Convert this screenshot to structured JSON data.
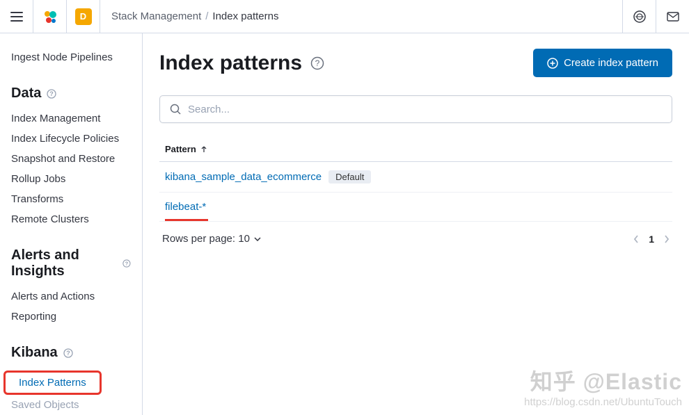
{
  "breadcrumb": {
    "parent": "Stack Management",
    "current": "Index patterns"
  },
  "space_badge": "D",
  "sidebar": {
    "ingest": {
      "pipelines": "Ingest Node Pipelines"
    },
    "data": {
      "heading": "Data",
      "items": [
        "Index Management",
        "Index Lifecycle Policies",
        "Snapshot and Restore",
        "Rollup Jobs",
        "Transforms",
        "Remote Clusters"
      ]
    },
    "alerts": {
      "heading": "Alerts and Insights",
      "items": [
        "Alerts and Actions",
        "Reporting"
      ]
    },
    "kibana": {
      "heading": "Kibana",
      "items": [
        "Index Patterns",
        "Saved Objects"
      ]
    }
  },
  "page": {
    "title": "Index patterns",
    "create_button": "Create index pattern",
    "search_placeholder": "Search...",
    "table": {
      "header": "Pattern",
      "rows": [
        {
          "name": "kibana_sample_data_ecommerce",
          "default": true
        },
        {
          "name": "filebeat-*",
          "default": false
        }
      ],
      "default_label": "Default"
    },
    "pagination": {
      "rows_label": "Rows per page: 10",
      "current_page": "1"
    }
  },
  "watermark": {
    "line1": "知乎 @Elastic",
    "line2": "https://blog.csdn.net/UbuntuTouch"
  }
}
